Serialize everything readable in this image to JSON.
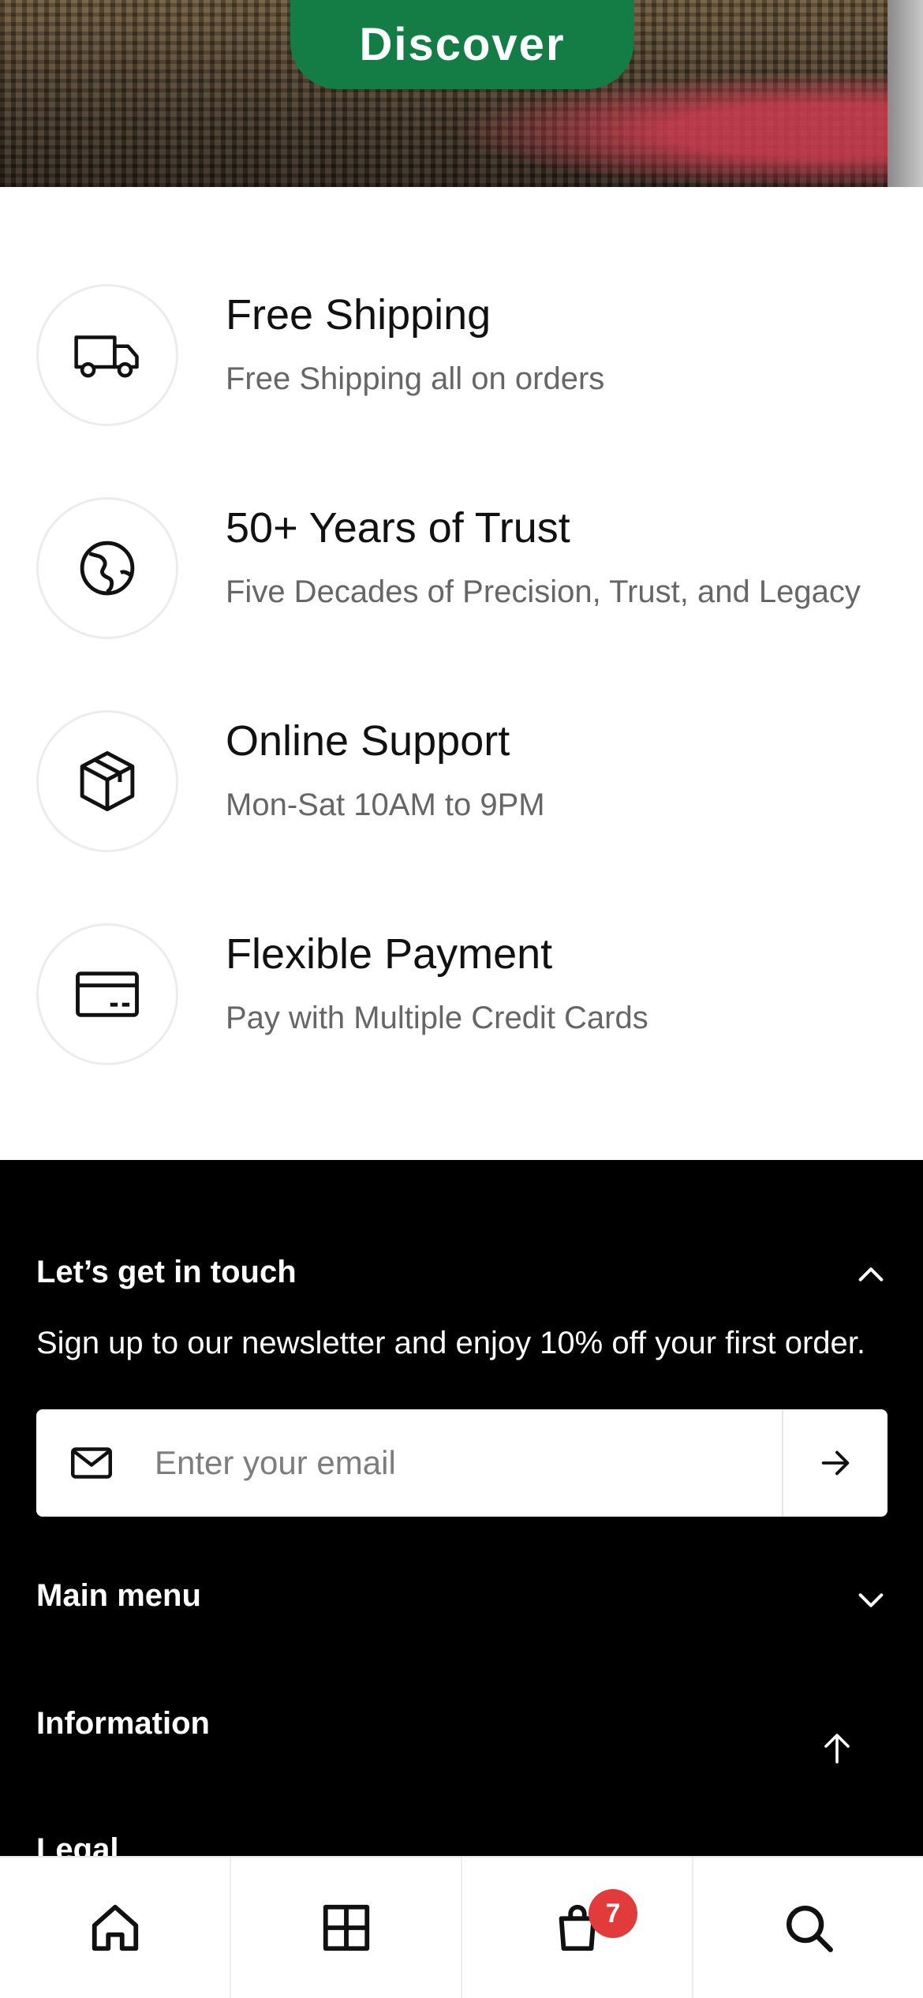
{
  "hero": {
    "discover_label": "Discover"
  },
  "features": [
    {
      "icon": "truck-icon",
      "title": "Free Shipping",
      "desc": "Free Shipping all on orders"
    },
    {
      "icon": "globe-icon",
      "title": "50+ Years of Trust",
      "desc": "Five Decades of Precision, Trust, and Legacy"
    },
    {
      "icon": "box-icon",
      "title": "Online Support",
      "desc": "Mon-Sat 10AM to 9PM"
    },
    {
      "icon": "credit-card-icon",
      "title": "Flexible Payment",
      "desc": "Pay with Multiple Credit Cards"
    }
  ],
  "footer": {
    "touch_heading": "Let’s get in touch",
    "newsletter_text": "Sign up to our newsletter and enjoy 10% off your first order.",
    "email_placeholder": "Enter your email",
    "main_menu_heading": "Main menu",
    "information_heading": "Information",
    "partial_heading": "Legal"
  },
  "bottom_nav": {
    "cart_count": "7",
    "items": [
      "home-icon",
      "grid-icon",
      "shopping-bag-icon",
      "search-icon"
    ]
  },
  "colors": {
    "accent": "#137d45",
    "badge": "#e23b3b",
    "footer_bg": "#000000"
  }
}
